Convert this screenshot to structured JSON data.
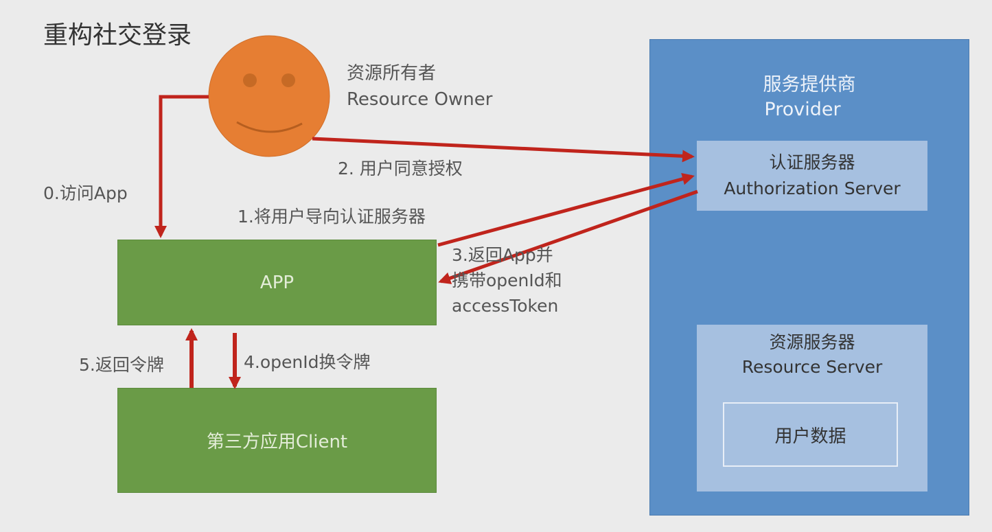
{
  "title": "重构社交登录",
  "resource_owner": {
    "cn": "资源所有者",
    "en": "Resource Owner"
  },
  "provider": {
    "cn": "服务提供商",
    "en": "Provider",
    "auth_server": {
      "cn": "认证服务器",
      "en": "Authorization Server"
    },
    "resource_server": {
      "cn": "资源服务器",
      "en": "Resource Server",
      "user_data": "用户数据"
    }
  },
  "app": {
    "label": "APP"
  },
  "client": {
    "label": "第三方应用Client"
  },
  "steps": {
    "s0": "0.访问App",
    "s1": "1.将用户导向认证服务器",
    "s2": "2. 用户同意授权",
    "s3_line1": "3.返回App并",
    "s3_line2": "携带openId和",
    "s3_line3": "accessToken",
    "s4": "4.openId换令牌",
    "s5": "5.返回令牌"
  },
  "colors": {
    "background": "#ebebeb",
    "arrow": "#c0241c",
    "face": "#e67e33",
    "app_green": "#6a9b47",
    "provider_blue": "#5b8fc7",
    "server_light_blue": "#a6c0e0"
  }
}
